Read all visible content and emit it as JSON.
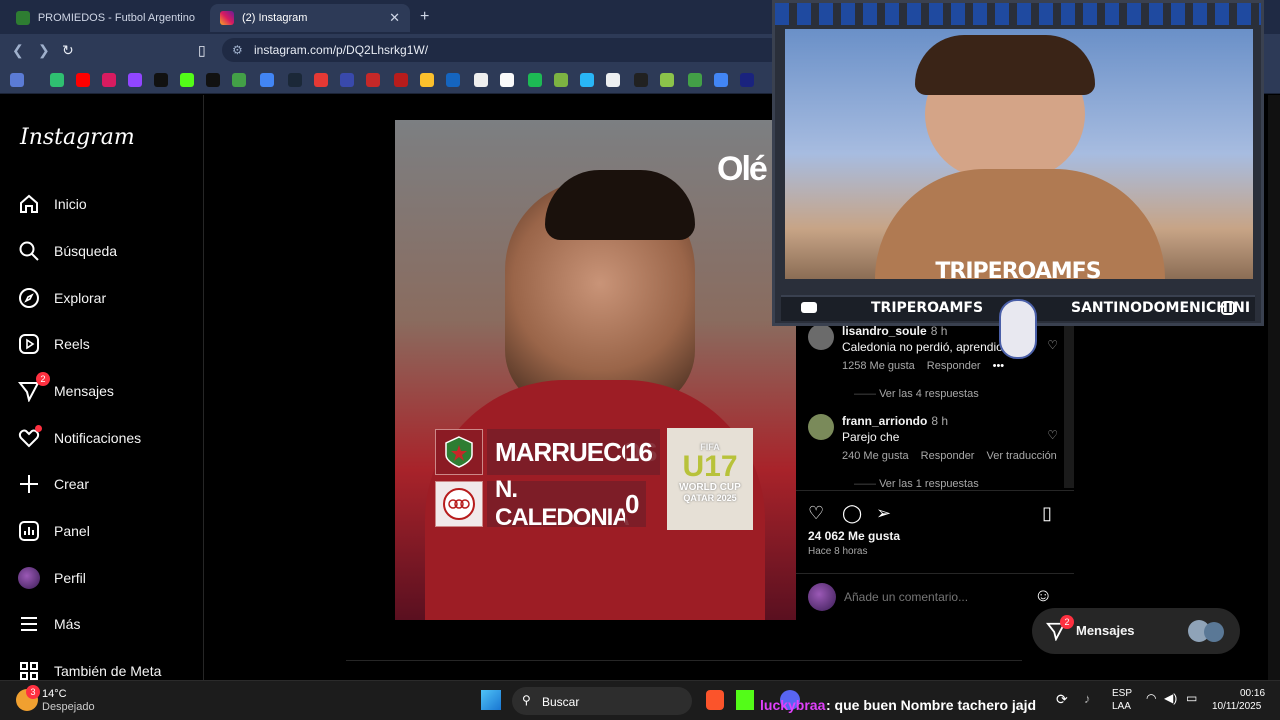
{
  "browser": {
    "tabs": [
      {
        "label": "PROMIEDOS - Futbol Argentino - Fix",
        "active": false
      },
      {
        "label": "(2) Instagram",
        "active": true
      }
    ],
    "url": "instagram.com/p/DQ2Lhsrkg1W/"
  },
  "instagram": {
    "logo": "Instagram",
    "nav": [
      {
        "label": "Inicio",
        "icon": "home-icon"
      },
      {
        "label": "Búsqueda",
        "icon": "search-icon"
      },
      {
        "label": "Explorar",
        "icon": "compass-icon"
      },
      {
        "label": "Reels",
        "icon": "reels-icon"
      },
      {
        "label": "Mensajes",
        "icon": "messages-icon",
        "badge": "2"
      },
      {
        "label": "Notificaciones",
        "icon": "heart-icon"
      },
      {
        "label": "Crear",
        "icon": "plus-icon"
      },
      {
        "label": "Panel",
        "icon": "dashboard-icon"
      },
      {
        "label": "Perfil",
        "icon": "avatar-icon"
      },
      {
        "label": "Más",
        "icon": "menu-icon"
      },
      {
        "label": "También de Meta",
        "icon": "meta-grid-icon"
      }
    ],
    "post": {
      "brand": "Olé",
      "team1": "MARRUECOS",
      "score1": "16",
      "team2": "N. CALEDONIA",
      "score2": "0",
      "tournament_top": "FIFA",
      "tournament_num": "U17",
      "tournament_bottom": "WORLD CUP",
      "tournament_place": "QATAR 2025"
    },
    "comments": [
      {
        "user": "lisandro_soule",
        "time": "8 h",
        "text": "Caledonia no perdió, aprendio",
        "likes": "1258 Me gusta",
        "reply": "Responder",
        "replies": "Ver las 4 respuestas"
      },
      {
        "user": "frann_arriondo",
        "time": "8 h",
        "text": "Parejo che",
        "likes": "240 Me gusta",
        "reply": "Responder",
        "translate": "Ver traducción",
        "replies": "Ver las 1 respuestas"
      }
    ],
    "likes_count": "24 062 Me gusta",
    "posted_ago": "Hace 8 horas",
    "comment_placeholder": "Añade un comentario...",
    "messages_fab": {
      "label": "Mensajes",
      "badge": "2"
    }
  },
  "stream_overlay": {
    "streamer": "TRIPEROAMFS",
    "youtube": "TRIPEROAMFS",
    "instagram": "SANTINODOMENICHINI"
  },
  "taskbar": {
    "weather_temp": "14°C",
    "weather_text": "Despejado",
    "weather_badge": "3",
    "search_label": "Buscar",
    "chat_user": "luckybraa",
    "chat_message": ": que buen Nombre tachero jajd",
    "lang_top": "ESP",
    "lang_bottom": "LAA",
    "time": "00:16",
    "date": "10/11/2025"
  }
}
